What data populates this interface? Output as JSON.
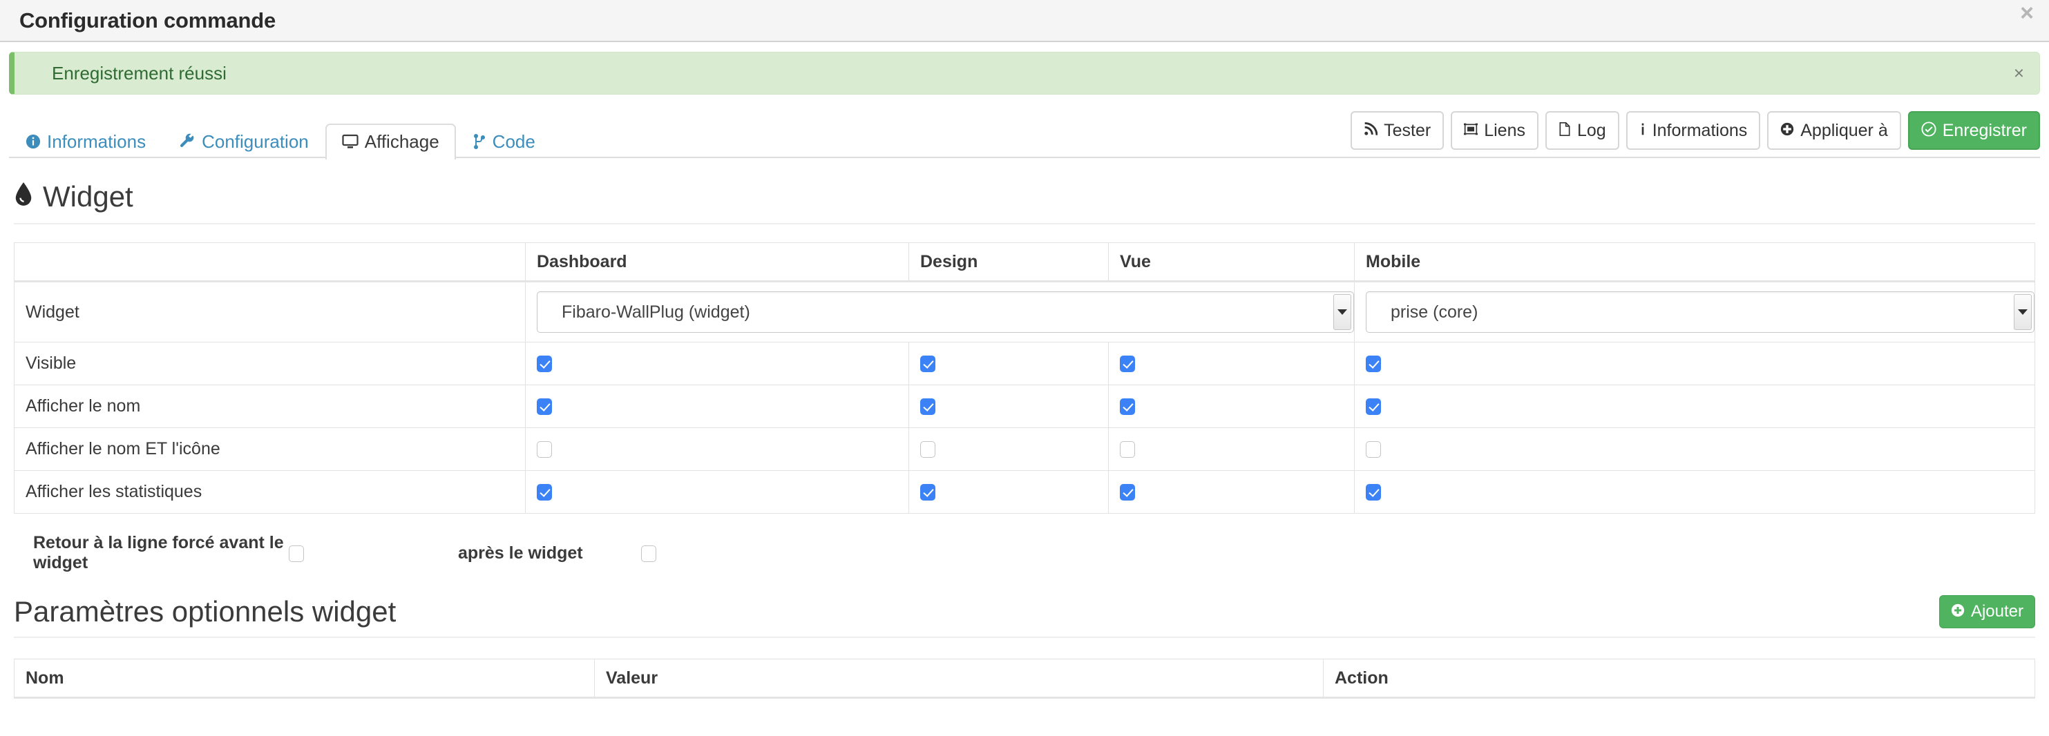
{
  "modal": {
    "title": "Configuration commande",
    "close_label": "×"
  },
  "alert": {
    "message": "Enregistrement réussi",
    "close_label": "×",
    "color": "#d9ecd2",
    "text_color": "#2f6b33",
    "accent": "#7cbf6a"
  },
  "tabs": [
    {
      "label": "Informations",
      "icon": "info-circle-icon",
      "active": false
    },
    {
      "label": "Configuration",
      "icon": "wrench-icon",
      "active": false
    },
    {
      "label": "Affichage",
      "icon": "desktop-icon",
      "active": true
    },
    {
      "label": "Code",
      "icon": "code-branch-icon",
      "active": false
    }
  ],
  "toolbar": {
    "tester_label": "Tester",
    "liens_label": "Liens",
    "log_label": "Log",
    "informations_label": "Informations",
    "appliquer_label": "Appliquer à",
    "enregistrer_label": "Enregistrer",
    "primary_color": "#4fb35f"
  },
  "widget_section": {
    "title": "Widget",
    "icon": "tint-icon",
    "columns": [
      "",
      "Dashboard",
      "Design",
      "Vue",
      "Mobile"
    ],
    "widget_row": {
      "label": "Widget",
      "dashboard_value": "Fibaro-WallPlug (widget)",
      "mobile_value": "prise (core)"
    },
    "rows": [
      {
        "label": "Visible",
        "dashboard": true,
        "design": true,
        "vue": true,
        "mobile": true
      },
      {
        "label": "Afficher le nom",
        "dashboard": true,
        "design": true,
        "vue": true,
        "mobile": true
      },
      {
        "label": "Afficher le nom ET l'icône",
        "dashboard": false,
        "design": false,
        "vue": false,
        "mobile": false
      },
      {
        "label": "Afficher les statistiques",
        "dashboard": true,
        "design": true,
        "vue": true,
        "mobile": true
      }
    ],
    "line_break": {
      "label_before": "Retour à la ligne forcé avant le widget",
      "checked_before": false,
      "label_after": "après le widget",
      "checked_after": false
    }
  },
  "optional_section": {
    "title": "Paramètres optionnels widget",
    "add_label": "Ajouter",
    "columns": [
      "Nom",
      "Valeur",
      "Action"
    ],
    "rows": []
  }
}
